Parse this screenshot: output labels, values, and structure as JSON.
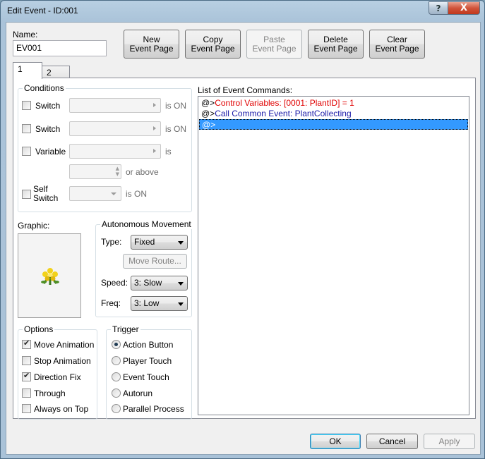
{
  "window": {
    "title": "Edit Event - ID:001"
  },
  "titlebar": {
    "help_glyph": "?",
    "close_glyph": "X"
  },
  "name_field": {
    "label": "Name:",
    "value": "EV001"
  },
  "toolbar": {
    "new_page": [
      "New",
      "Event Page"
    ],
    "copy_page": [
      "Copy",
      "Event Page"
    ],
    "paste_page": [
      "Paste",
      "Event Page"
    ],
    "delete_page": [
      "Delete",
      "Event Page"
    ],
    "clear_page": [
      "Clear",
      "Event Page"
    ]
  },
  "tabs": [
    {
      "label": "1",
      "active": true
    },
    {
      "label": "2",
      "active": false
    }
  ],
  "conditions": {
    "title": "Conditions",
    "switch1": {
      "label": "Switch",
      "suffix": "is ON",
      "checked": false
    },
    "switch2": {
      "label": "Switch",
      "suffix": "is ON",
      "checked": false
    },
    "variable": {
      "label": "Variable",
      "suffix": "is",
      "or_above": "or above",
      "checked": false
    },
    "self_switch": {
      "label_line1": "Self",
      "label_line2": "Switch",
      "suffix": "is ON",
      "checked": false
    }
  },
  "graphic": {
    "label": "Graphic:",
    "icon": "flower-sprite-icon"
  },
  "autonomous": {
    "title": "Autonomous Movement",
    "type_label": "Type:",
    "type_value": "Fixed",
    "move_route": "Move Route...",
    "speed_label": "Speed:",
    "speed_value": "3: Slow",
    "freq_label": "Freq:",
    "freq_value": "3: Low"
  },
  "options": {
    "title": "Options",
    "items": [
      {
        "label": "Move Animation",
        "checked": true
      },
      {
        "label": "Stop Animation",
        "checked": false
      },
      {
        "label": "Direction Fix",
        "checked": true
      },
      {
        "label": "Through",
        "checked": false
      },
      {
        "label": "Always on Top",
        "checked": false
      }
    ]
  },
  "trigger": {
    "title": "Trigger",
    "items": [
      {
        "label": "Action Button",
        "selected": true
      },
      {
        "label": "Player Touch",
        "selected": false
      },
      {
        "label": "Event Touch",
        "selected": false
      },
      {
        "label": "Autorun",
        "selected": false
      },
      {
        "label": "Parallel Process",
        "selected": false
      }
    ]
  },
  "commands": {
    "label": "List of Event Commands:",
    "items": [
      {
        "prefix": "@>",
        "text": "Control Variables: [0001: PlantID] = 1",
        "color": "#e00000",
        "selected": false
      },
      {
        "prefix": "@>",
        "text": "Call Common Event: PlantCollecting",
        "color": "#1a1aa8",
        "selected": false
      },
      {
        "prefix": "@>",
        "text": "",
        "color": "#ffffff",
        "selected": true
      }
    ]
  },
  "footer": {
    "ok": "OK",
    "cancel": "Cancel",
    "apply": "Apply"
  },
  "colors": {
    "selection": "#3399ff",
    "control_variables": "#e00000",
    "common_event": "#1a1aa8"
  }
}
